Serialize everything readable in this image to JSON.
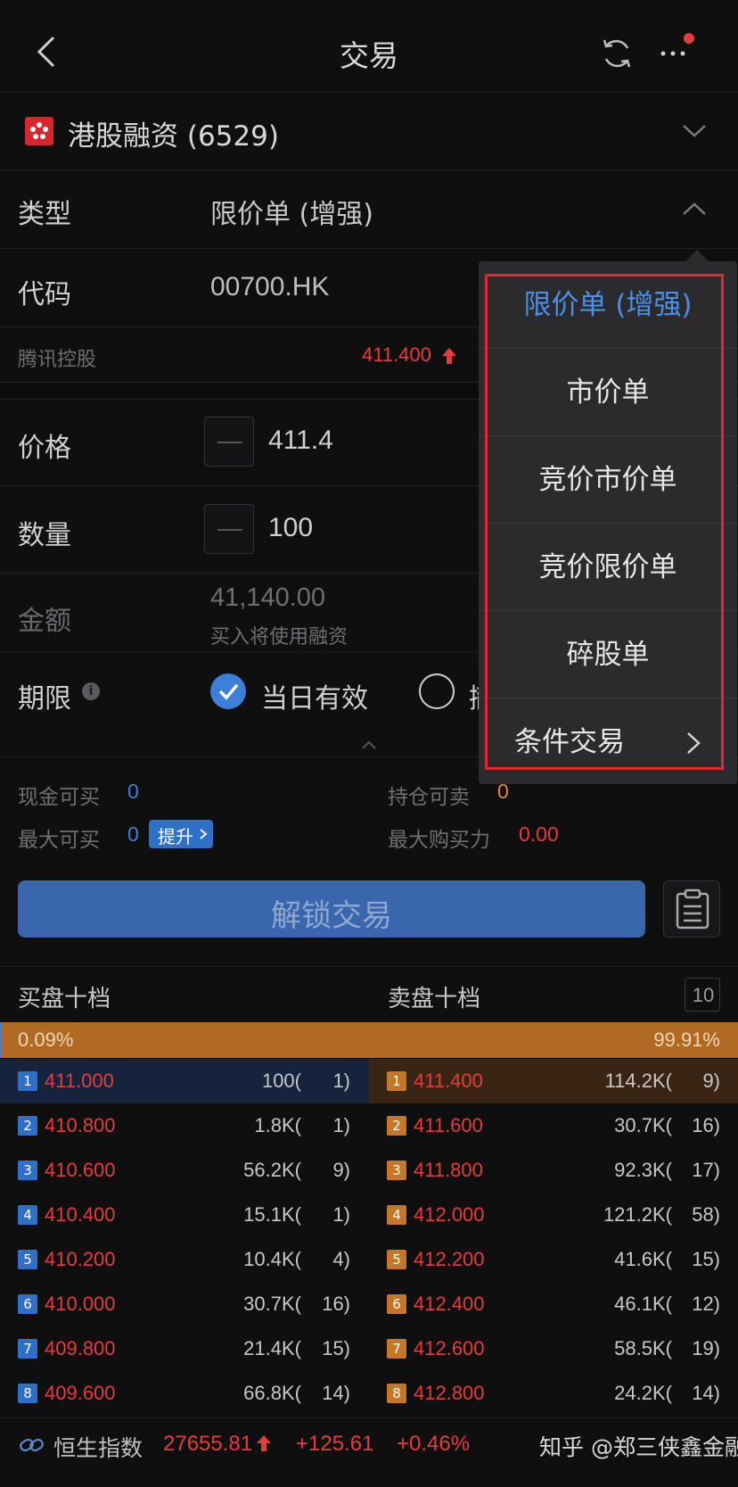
{
  "nav": {
    "title": "交易"
  },
  "account": {
    "name": "港股融资 (6529)"
  },
  "form": {
    "type_label": "类型",
    "type_value": "限价单 (增强)",
    "code_label": "代码",
    "code_value": "00700.HK",
    "stock_name": "腾讯控股",
    "stock_price": "411.400",
    "price_label": "价格",
    "price_value": "411.4",
    "qty_label": "数量",
    "qty_value": "100",
    "amount_label": "金额",
    "amount_value": "41,140.00",
    "amount_note": "买入将使用融资",
    "expiry_label": "期限",
    "expiry_option1": "当日有效",
    "expiry_option2": "撤"
  },
  "dropdown": {
    "items": [
      "限价单 (增强)",
      "市价单",
      "竞价市价单",
      "竞价限价单",
      "碎股单",
      "条件交易"
    ]
  },
  "summary": {
    "cash_buy_label": "现金可买",
    "cash_buy_value": "0",
    "pos_sell_label": "持仓可卖",
    "pos_sell_value": "0",
    "max_buy_label": "最大可买",
    "max_buy_value": "0",
    "boost_label": "提升",
    "max_power_label": "最大购买力",
    "max_power_value": "0.00"
  },
  "unlock_button": "解锁交易",
  "orderbook": {
    "bid_title": "买盘十档",
    "ask_title": "卖盘十档",
    "depth": "10",
    "bid_pct": "0.09%",
    "ask_pct": "99.91%",
    "bids": [
      {
        "lvl": "1",
        "price": "411.000",
        "qty": "100(",
        "cnt": "1)"
      },
      {
        "lvl": "2",
        "price": "410.800",
        "qty": "1.8K(",
        "cnt": "1)"
      },
      {
        "lvl": "3",
        "price": "410.600",
        "qty": "56.2K(",
        "cnt": "9)"
      },
      {
        "lvl": "4",
        "price": "410.400",
        "qty": "15.1K(",
        "cnt": "1)"
      },
      {
        "lvl": "5",
        "price": "410.200",
        "qty": "10.4K(",
        "cnt": "4)"
      },
      {
        "lvl": "6",
        "price": "410.000",
        "qty": "30.7K(",
        "cnt": "16)"
      },
      {
        "lvl": "7",
        "price": "409.800",
        "qty": "21.4K(",
        "cnt": "15)"
      },
      {
        "lvl": "8",
        "price": "409.600",
        "qty": "66.8K(",
        "cnt": "14)"
      }
    ],
    "asks": [
      {
        "lvl": "1",
        "price": "411.400",
        "qty": "114.2K(",
        "cnt": "9)"
      },
      {
        "lvl": "2",
        "price": "411.600",
        "qty": "30.7K(",
        "cnt": "16)"
      },
      {
        "lvl": "3",
        "price": "411.800",
        "qty": "92.3K(",
        "cnt": "17)"
      },
      {
        "lvl": "4",
        "price": "412.000",
        "qty": "121.2K(",
        "cnt": "58)"
      },
      {
        "lvl": "5",
        "price": "412.200",
        "qty": "41.6K(",
        "cnt": "15)"
      },
      {
        "lvl": "6",
        "price": "412.400",
        "qty": "46.1K(",
        "cnt": "12)"
      },
      {
        "lvl": "7",
        "price": "412.600",
        "qty": "58.5K(",
        "cnt": "19)"
      },
      {
        "lvl": "8",
        "price": "412.800",
        "qty": "24.2K(",
        "cnt": "14)"
      }
    ]
  },
  "ticker": {
    "name": "恒生指数",
    "value": "27655.81",
    "change": "+125.61",
    "pct": "+0.46%"
  },
  "watermark": "知乎 @郑三侠鑫金融",
  "colors": {
    "accent": "#3b7fd8",
    "up": "#e53d3d",
    "ask": "#e0883a",
    "frame": "#e0282d"
  }
}
